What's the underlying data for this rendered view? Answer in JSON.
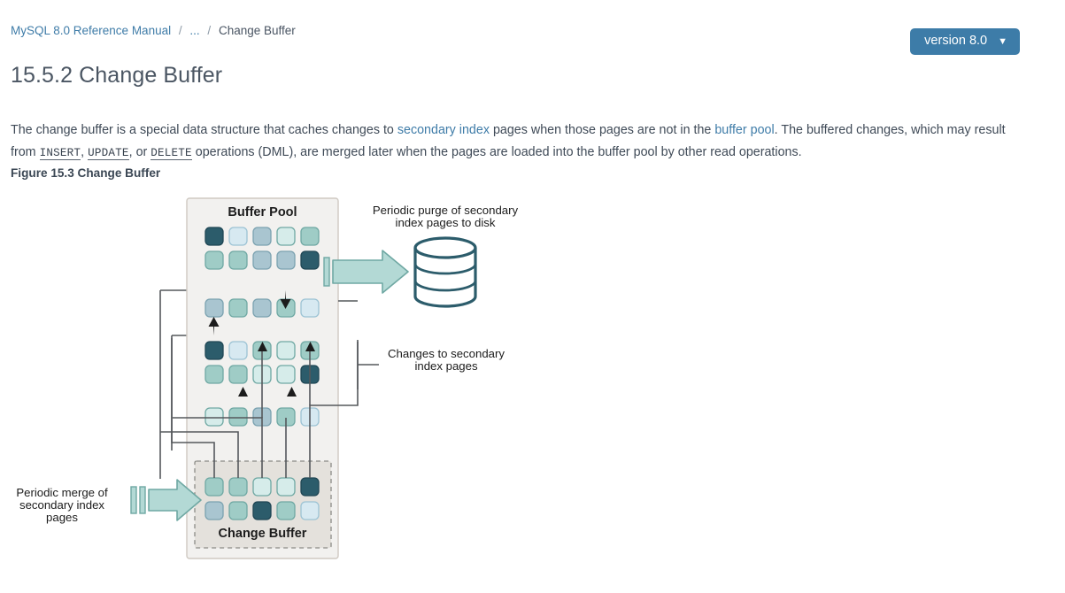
{
  "breadcrumb": {
    "root_label": "MySQL 8.0 Reference Manual",
    "sep": "/",
    "ellipsis": "...",
    "current_label": "Change Buffer"
  },
  "version_selector": {
    "label": "version 8.0",
    "chevron_icon": "chevron-down-icon",
    "color": "#3d7ca8"
  },
  "page": {
    "title": "15.5.2 Change Buffer",
    "figure_caption": "Figure 15.3 Change Buffer"
  },
  "intro": {
    "t1": "The change buffer is a special data structure that caches changes to ",
    "link1": "secondary index",
    "t2": " pages when those pages are not in the ",
    "link2": "buffer pool",
    "t3": ". The buffered changes, which may result from ",
    "code1": "INSERT",
    "t4": ", ",
    "code2": "UPDATE",
    "t5": ", or ",
    "code3": "DELETE",
    "t6": " operations (DML), are merged later when the pages are loaded into the buffer pool by other read operations."
  },
  "figure": {
    "buffer_pool_title": "Buffer Pool",
    "change_buffer_title": "Change Buffer",
    "purge_label_line1": "Periodic purge of secondary",
    "purge_label_line2": "index pages to disk",
    "changes_label_line1": "Changes to secondary",
    "changes_label_line2": "index pages",
    "merge_label_line1": "Periodic merge of",
    "merge_label_line2": "secondary index",
    "merge_label_line3": "pages",
    "disk_icon": "database-cylinder-icon",
    "purge_arrow_icon": "right-arrow-icon",
    "merge_arrow_icon": "right-arrow-icon",
    "colors": {
      "panel_bg": "#f2f1ef",
      "panel_border": "#cfc9c2",
      "change_buffer_bg": "#e4e1dc",
      "dark_teal": "#2c5c6b",
      "mid_teal": "#9fccc6",
      "pale_teal": "#d6ecea",
      "blue_gray": "#a9c5d0",
      "ice_blue": "#d7e9f1",
      "arrow_fill": "#b3d9d5",
      "arrow_stroke": "#6fa8a3",
      "connector": "#55585c"
    },
    "buffer_pool_rows": [
      [
        "dark_teal",
        "ice_blue",
        "blue_gray",
        "pale_teal",
        "mid_teal"
      ],
      [
        "mid_teal",
        "mid_teal",
        "blue_gray",
        "blue_gray",
        "dark_teal"
      ],
      [
        "blue_gray",
        "mid_teal",
        "blue_gray",
        "mid_teal",
        "ice_blue"
      ],
      [
        "dark_teal",
        "ice_blue",
        "mid_teal",
        "pale_teal",
        "mid_teal"
      ],
      [
        "mid_teal",
        "mid_teal",
        "pale_teal",
        "pale_teal",
        "dark_teal"
      ],
      [
        "pale_teal",
        "mid_teal",
        "blue_gray",
        "mid_teal",
        "ice_blue"
      ]
    ],
    "change_buffer_rows": [
      [
        "mid_teal",
        "mid_teal",
        "pale_teal",
        "pale_teal",
        "dark_teal"
      ],
      [
        "blue_gray",
        "mid_teal",
        "dark_teal",
        "mid_teal",
        "ice_blue"
      ]
    ]
  }
}
